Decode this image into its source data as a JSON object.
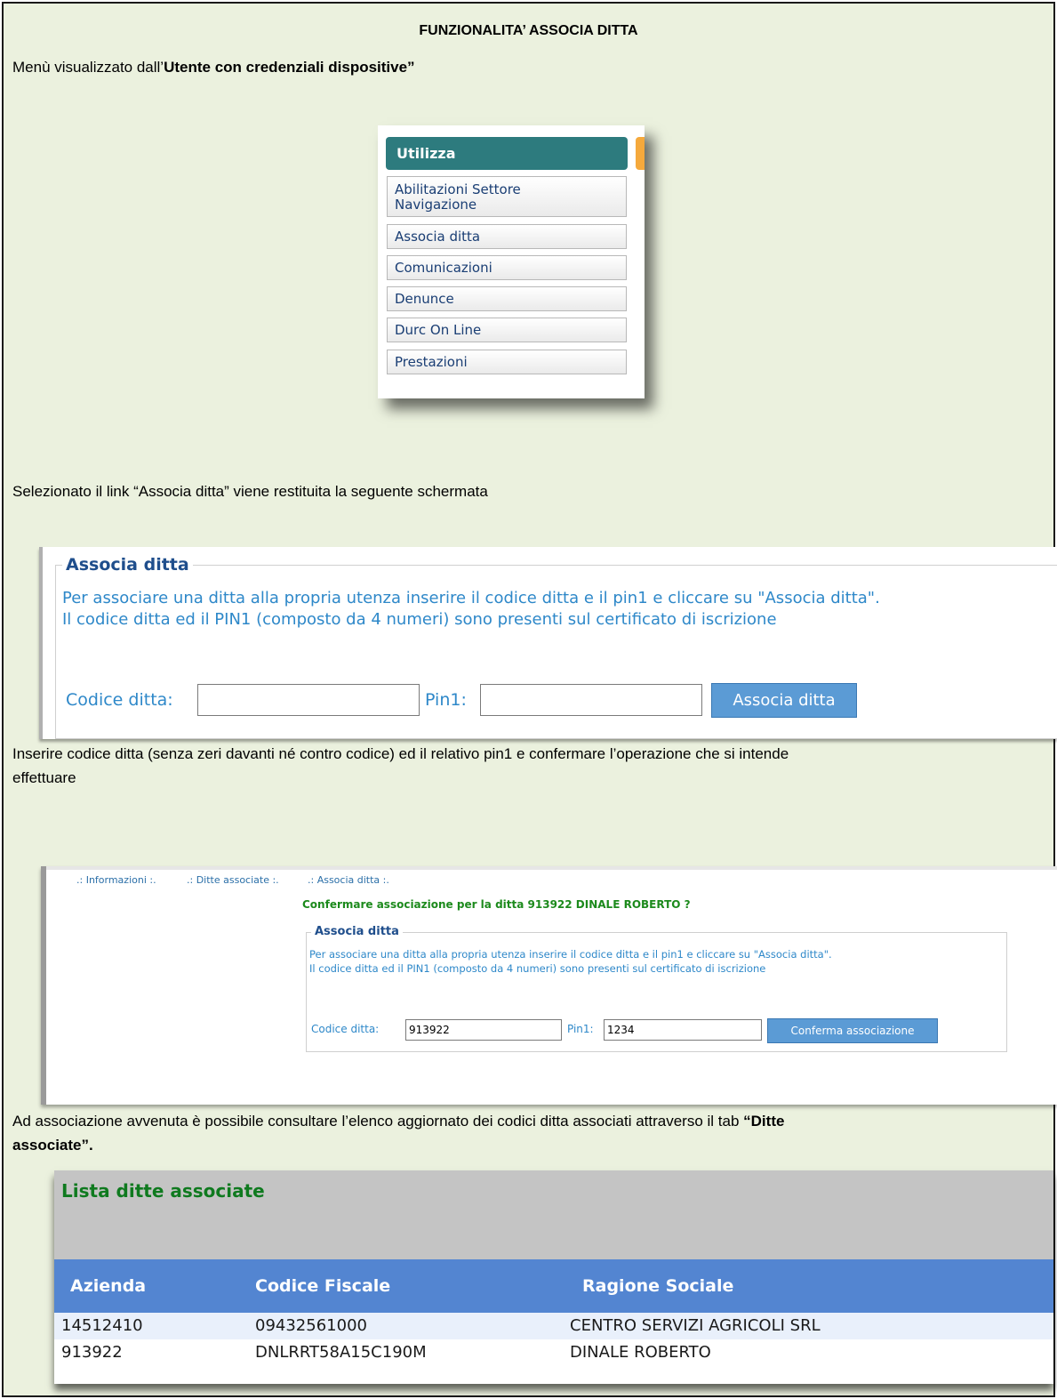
{
  "doc": {
    "title": "FUNZIONALITA’ ASSOCIA DITTA",
    "p1_prefix": "Menù visualizzato dall’",
    "p1_bold": "Utente con credenziali dispositive”",
    "p2": "Selezionato il link “Associa ditta” viene restituita la seguente schermata",
    "p3_line1": "Inserire codice ditta (senza zeri davanti né contro codice) ed il relativo pin1 e confermare l’operazione che si intende",
    "p3_line2": "effettuare",
    "p4_line1_prefix": "Ad associazione avvenuta è possibile consultare l’elenco aggiornato dei codici ditta associati attraverso il tab ",
    "p4_line1_bold": "“Ditte",
    "p4_line2_bold": "associate”."
  },
  "menu": {
    "header": "Utilizza",
    "items": [
      {
        "label_line1": "Abilitazioni Settore",
        "label_line2": "Navigazione"
      },
      {
        "label_line1": "Associa ditta"
      },
      {
        "label_line1": "Comunicazioni"
      },
      {
        "label_line1": "Denunce"
      },
      {
        "label_line1": "Durc On Line"
      },
      {
        "label_line1": "Prestazioni"
      }
    ]
  },
  "form": {
    "legend": "Associa ditta",
    "text_line1": "Per associare una ditta alla propria utenza inserire il codice ditta e il pin1 e cliccare su \"Associa ditta\".",
    "text_line2": "Il codice ditta ed il PIN1 (composto da 4 numeri) sono presenti sul certificato di iscrizione",
    "codice_label": "Codice ditta:",
    "codice_value": "",
    "pin_label": "Pin1:",
    "pin_value": "",
    "button": "Associa ditta"
  },
  "confirm": {
    "tabs": [
      ".: Informazioni :.",
      ".: Ditte associate :.",
      ".: Associa ditta :."
    ],
    "question": "Confermare associazione per la ditta 913922 DINALE ROBERTO ?",
    "legend": "Associa ditta",
    "text_line1": "Per associare una ditta alla propria utenza inserire il codice ditta e il pin1 e cliccare su \"Associa ditta\".",
    "text_line2": "Il codice ditta ed il PIN1 (composto da 4 numeri) sono presenti sul certificato di iscrizione",
    "codice_label": "Codice ditta:",
    "codice_value": "913922",
    "pin_label": "Pin1:",
    "pin_value": "1234",
    "button": "Conferma associazione"
  },
  "list": {
    "title": "Lista ditte associate",
    "columns": [
      "Azienda",
      "Codice Fiscale",
      "Ragione Sociale"
    ],
    "rows": [
      [
        "14512410",
        "09432561000",
        "CENTRO SERVIZI AGRICOLI SRL"
      ],
      [
        "913922",
        "DNLRRT58A15C190M",
        "DINALE ROBERTO"
      ]
    ]
  }
}
